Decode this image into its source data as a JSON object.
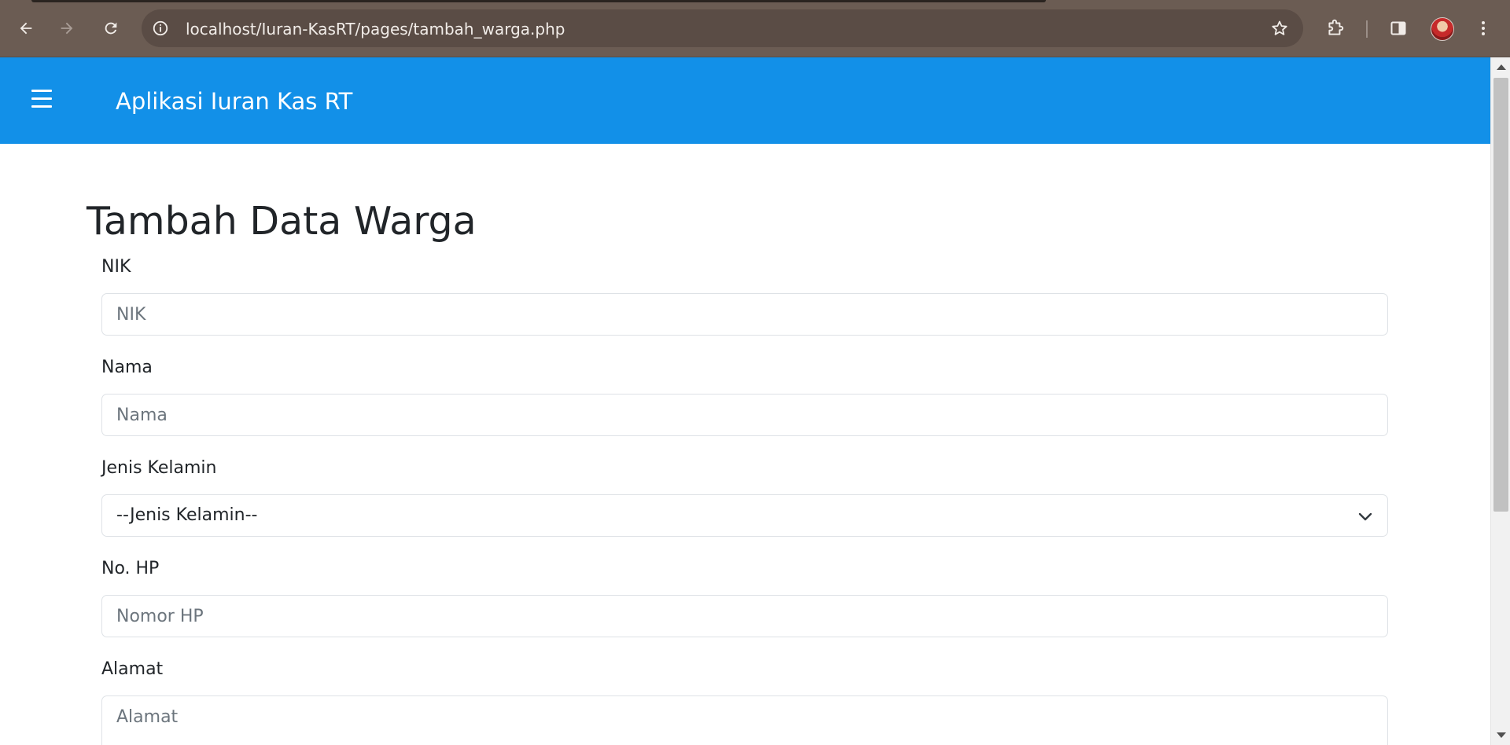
{
  "browser": {
    "url": "localhost/Iuran-KasRT/pages/tambah_warga.php",
    "icons": {
      "back": "back-arrow-icon",
      "forward": "forward-arrow-icon",
      "reload": "reload-icon",
      "site_info": "info-icon",
      "bookmark": "star-icon",
      "extensions": "puzzle-icon",
      "side_panel": "side-panel-icon",
      "profile": "avatar",
      "menu": "kebab-menu-icon"
    }
  },
  "header": {
    "app_title": "Aplikasi Iuran Kas RT",
    "menu_icon": "hamburger-icon",
    "color": "#1290e8"
  },
  "form": {
    "title": "Tambah Data Warga",
    "fields": [
      {
        "label": "NIK",
        "placeholder": "NIK",
        "value": ""
      },
      {
        "label": "Nama",
        "placeholder": "Nama",
        "value": ""
      },
      {
        "label": "Jenis Kelamin",
        "selected": "--Jenis Kelamin--"
      },
      {
        "label": "No. HP",
        "placeholder": "Nomor HP",
        "value": ""
      },
      {
        "label": "Alamat",
        "placeholder": "Alamat",
        "value": ""
      }
    ]
  }
}
